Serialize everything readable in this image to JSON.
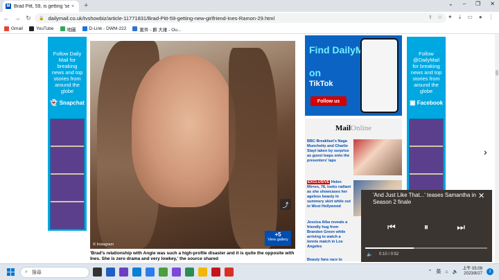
{
  "browser": {
    "tab": {
      "favicon_text": "M",
      "title": "Brad Pitt, 59, is getting 'seriou",
      "close": "×"
    },
    "new_tab": "+",
    "window_controls": [
      "⌄",
      "–",
      "❐",
      "✕"
    ],
    "url": "dailymail.co.uk/tvshowbiz/article-11771831/Brad-Pitt-59-getting-new-girlfriend-Ines-Ramon-29.html",
    "bookmarks": [
      {
        "label": "Gmail",
        "color": "#ea4335"
      },
      {
        "label": "YouTube",
        "color": "#202124"
      },
      {
        "label": "地圖",
        "color": "#34a853"
      },
      {
        "label": "D-Link - DWM-222",
        "color": "#1a73e8"
      },
      {
        "label": "案件 - 爵 大維 - Ou...",
        "color": "#2f6fd6"
      }
    ]
  },
  "page": {
    "left_ad": {
      "text": "Follow Daily Mail for breaking news and top stories from around the globe",
      "brand": "Snapchat",
      "icon": "snapchat-icon"
    },
    "right_ad": {
      "text": "Follow @DailyMail for breaking news and top stories from around the globe",
      "brand": "Facebook",
      "icon": "facebook-icon"
    },
    "hero": {
      "credit": "© Instagram",
      "gallery_count": "+5",
      "gallery_label": "View gallery",
      "share_icon": "share-icon"
    },
    "caption": "'Brad's relationship with Angie was such a high-profile disaster and it is quite the opposite with Ines. She is zero drama and very lowkey,' the source shared",
    "tiktok_ad": {
      "line1": "Find DailyMail",
      "line2": "on",
      "line3": "TikTok",
      "button": "Follow us"
    },
    "mailonline": {
      "logo_bold": "Mail",
      "logo_light": "Online",
      "stories": [
        {
          "tag": "",
          "text": "BBC Breakfast's Naga Munchetty and Charlie Stayt taken by surprise as guest leaps onto the presenters' laps"
        },
        {
          "tag": "EXCLUSIVE",
          "text": "Helen Mirren, 78, looks radiant as she showcases her ageless beauty in summery skirt while out in West Hollywood"
        },
        {
          "tag": "",
          "text": "Jessica Alba reveals a friendly hug from Brandon Green while arriving to watch a tennis match in Los Angeles"
        },
        {
          "tag": "",
          "text": "Beauty fans race to"
        }
      ]
    },
    "next_arrow": "›"
  },
  "video": {
    "title": "'And Just Like That...' teases Samantha in Season 2 finale",
    "close": "✕",
    "time": "0:10 / 0:52",
    "progress": 0.4
  },
  "taskbar": {
    "search_placeholder": "搜尋",
    "ime": "英",
    "time": "上午 05:09",
    "date": "2023/8/27",
    "notifications": "1",
    "app_colors": [
      "#333",
      "#1f5fbf",
      "#6b3fc1",
      "#0a7fd4",
      "#2b7de9",
      "#4a9f3c",
      "#7b4ad8",
      "#2e8b57",
      "#f2b705",
      "#c4151c",
      "#d93025"
    ]
  }
}
